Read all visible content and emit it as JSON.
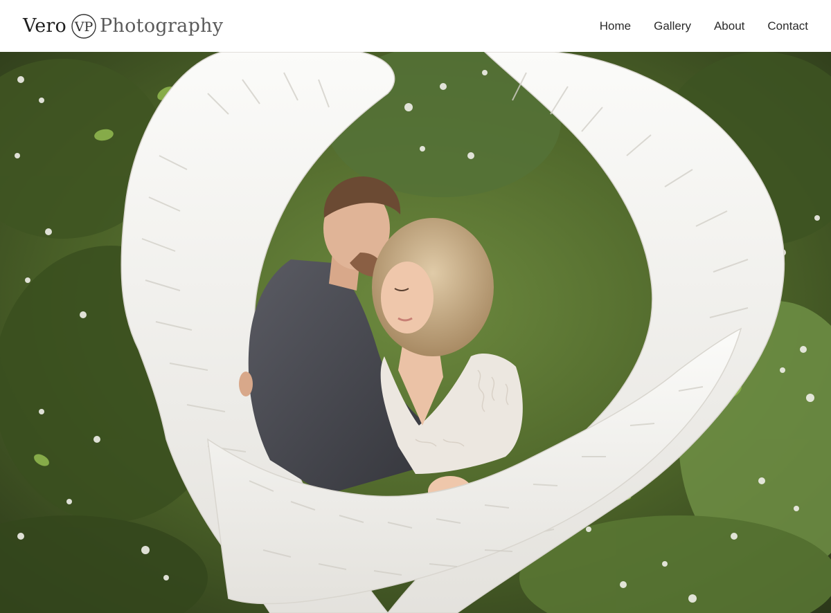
{
  "brand": {
    "name_left": "Vero",
    "monogram": "VP",
    "name_right": "Photography"
  },
  "nav": {
    "items": [
      {
        "label": "Home"
      },
      {
        "label": "Gallery"
      },
      {
        "label": "About"
      },
      {
        "label": "Contact"
      }
    ]
  },
  "hero": {
    "image_alt": "Couple embracing in front of large white angel wings surrounded by blossoming green foliage",
    "colors": {
      "foliage_dark": "#2f3d1f",
      "foliage_mid": "#5c7a35",
      "foliage_light": "#9bbf5a",
      "wings": "#f3f2ef",
      "suit": "#4a4b52",
      "dress": "#ece7e0",
      "hair": "#c9b18e",
      "skin": "#e8c0a3"
    }
  }
}
